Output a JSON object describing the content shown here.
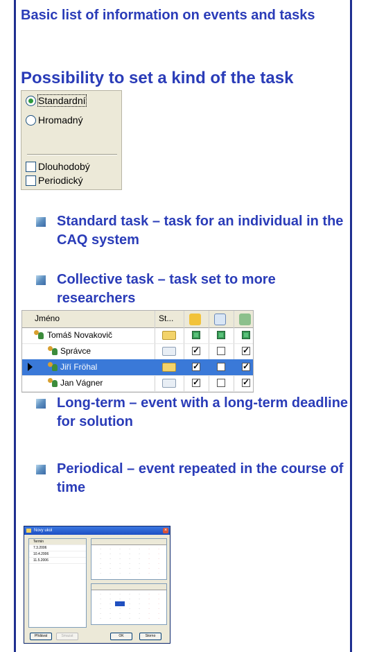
{
  "header": "Basic list of information on events and tasks",
  "section_title": "Possibility to set a kind of the task",
  "options": [
    {
      "label": "Standardní",
      "type": "radio",
      "checked": true
    },
    {
      "label": "Hromadný",
      "type": "radio",
      "checked": false
    },
    {
      "label": "Dlouhodobý",
      "type": "checkbox",
      "checked": false
    },
    {
      "label": "Periodický",
      "type": "checkbox",
      "checked": false
    }
  ],
  "bullets": [
    {
      "text": "Standard task – task for an individual in the CAQ system"
    },
    {
      "text": "Collective task – task set to more researchers"
    },
    {
      "text": "Long-term – event with a long-term deadline for solution"
    },
    {
      "text": "Periodical – event repeated in the course of time"
    }
  ],
  "grid": {
    "header_name": "Jméno",
    "header_col2": "St...",
    "rows": [
      {
        "name": "Tomáš Novakovič",
        "selected": false
      },
      {
        "name": "Správce",
        "selected": false
      },
      {
        "name": "Jiří Fröhal",
        "selected": true
      },
      {
        "name": "Jan Vágner",
        "selected": false
      }
    ]
  },
  "dialog": {
    "title": "Novy ukol",
    "list_header": "Termin",
    "dates": [
      "7.3.2006",
      "10.4.2006",
      "11.5.2006"
    ],
    "buttons": [
      "Přidávat",
      "Smazat",
      "OK",
      "Storno"
    ]
  },
  "colors": {
    "accent": "#2a3cb8",
    "frame": "#1f2f90",
    "bullet": "#5d8fc0",
    "selection": "#3a79d8"
  }
}
